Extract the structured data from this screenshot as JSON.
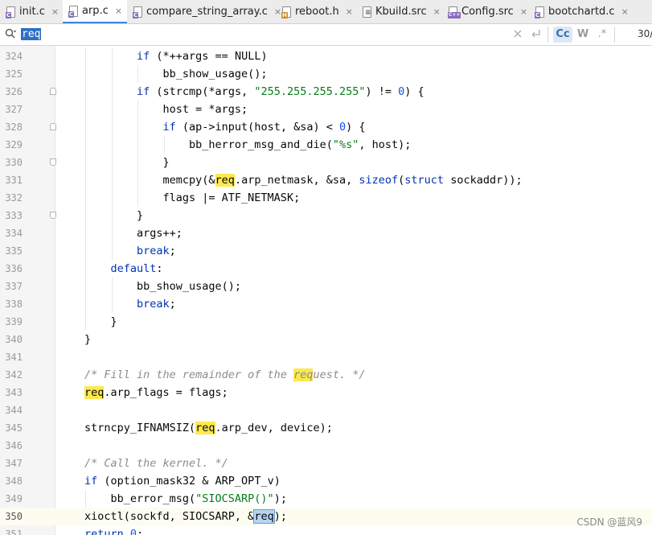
{
  "tabs": [
    {
      "label": "init.c",
      "icon": "c-file-icon"
    },
    {
      "label": "arp.c",
      "icon": "c-file-icon",
      "active": true
    },
    {
      "label": "compare_string_array.c",
      "icon": "c-file-icon"
    },
    {
      "label": "reboot.h",
      "icon": "h-file-icon"
    },
    {
      "label": "Kbuild.src",
      "icon": "kbuild-file-icon"
    },
    {
      "label": "Config.src",
      "icon": "cpp-file-icon"
    },
    {
      "label": "bootchartd.c",
      "icon": "c-file-icon"
    }
  ],
  "tab_close_glyph": "×",
  "search": {
    "query": "req",
    "match_count": "30/",
    "case_label": "Cc",
    "words_label": "W",
    "regex_label": ".*"
  },
  "editor": {
    "current_line": 350,
    "lines": [
      {
        "n": 324,
        "text": "            if (*++args == NULL)"
      },
      {
        "n": 325,
        "text": "                bb_show_usage();"
      },
      {
        "n": 326,
        "text": "            if (strcmp(*args, \"255.255.255.255\") != 0) {"
      },
      {
        "n": 327,
        "text": "                host = *args;"
      },
      {
        "n": 328,
        "text": "                if (ap->input(host, &sa) < 0) {"
      },
      {
        "n": 329,
        "text": "                    bb_herror_msg_and_die(\"%s\", host);"
      },
      {
        "n": 330,
        "text": "                }"
      },
      {
        "n": 331,
        "text": "                memcpy(&req.arp_netmask, &sa, sizeof(struct sockaddr));"
      },
      {
        "n": 332,
        "text": "                flags |= ATF_NETMASK;"
      },
      {
        "n": 333,
        "text": "            }"
      },
      {
        "n": 334,
        "text": "            args++;"
      },
      {
        "n": 335,
        "text": "            break;"
      },
      {
        "n": 336,
        "text": "        default:"
      },
      {
        "n": 337,
        "text": "            bb_show_usage();"
      },
      {
        "n": 338,
        "text": "            break;"
      },
      {
        "n": 339,
        "text": "        }"
      },
      {
        "n": 340,
        "text": "    }"
      },
      {
        "n": 341,
        "text": ""
      },
      {
        "n": 342,
        "text": "    /* Fill in the remainder of the request. */"
      },
      {
        "n": 343,
        "text": "    req.arp_flags = flags;"
      },
      {
        "n": 344,
        "text": ""
      },
      {
        "n": 345,
        "text": "    strncpy_IFNAMSIZ(req.arp_dev, device);"
      },
      {
        "n": 346,
        "text": ""
      },
      {
        "n": 347,
        "text": "    /* Call the kernel. */"
      },
      {
        "n": 348,
        "text": "    if (option_mask32 & ARP_OPT_v)"
      },
      {
        "n": 349,
        "text": "        bb_error_msg(\"SIOCSARP()\");"
      },
      {
        "n": 350,
        "text": "    xioctl(sockfd, SIOCSARP, &req);"
      },
      {
        "n": 351,
        "text": "    return 0;"
      }
    ]
  },
  "watermark": "CSDN @蓝风9",
  "colors": {
    "keyword": "#0033b3",
    "string": "#067d17",
    "number": "#1750eb",
    "comment": "#8c8c8c",
    "search_highlight": "#fce94f",
    "current_match": "#b6d4f2",
    "accent": "#3f86e0"
  }
}
